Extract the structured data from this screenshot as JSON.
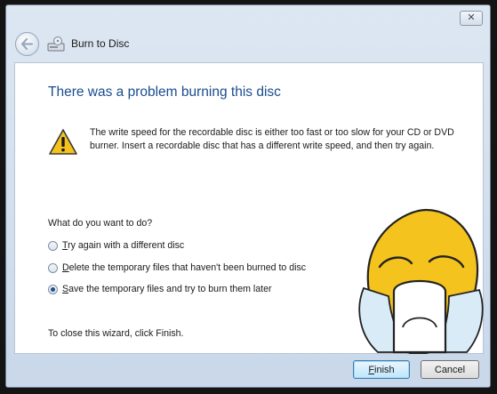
{
  "window": {
    "title": "Burn to Disc",
    "close_glyph": "✕"
  },
  "content": {
    "heading": "There was a problem burning this disc",
    "error_message": "The write speed for the recordable disc is either too fast or too slow for your CD or DVD burner. Insert a recordable disc that has a different write speed, and then try again.",
    "question": "What do you want to do?",
    "options": [
      {
        "accel": "T",
        "rest": "ry again with a different disc",
        "selected": false
      },
      {
        "accel": "D",
        "rest": "elete the temporary files that haven't been burned to disc",
        "selected": false
      },
      {
        "accel": "S",
        "rest": "ave the temporary files and try to burn them later",
        "selected": true
      }
    ],
    "close_hint": "To close this wizard, click Finish."
  },
  "footer": {
    "finish": {
      "accel": "F",
      "rest": "inish"
    },
    "cancel_label": "Cancel"
  },
  "colors": {
    "heading": "#1b4d8f",
    "accent": "#3c7fb1",
    "warning": "#f4c21b",
    "face": "#f5c31d"
  },
  "icons": [
    "close-icon",
    "back-arrow-icon",
    "disc-burner-icon",
    "warning-icon",
    "crying-face-icon"
  ]
}
